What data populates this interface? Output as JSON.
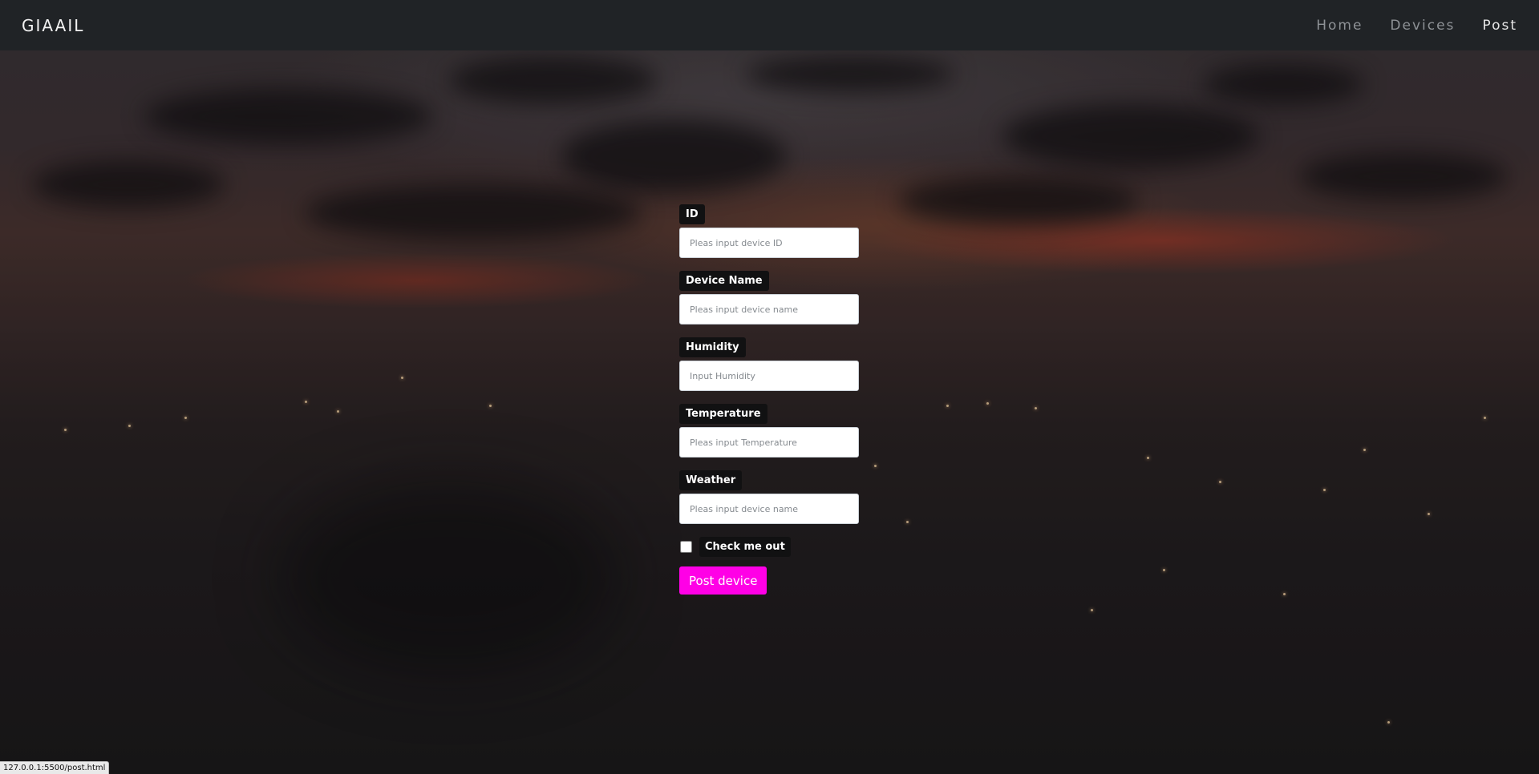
{
  "navbar": {
    "brand": "GIAAIL",
    "links": [
      {
        "label": "Home",
        "active": false
      },
      {
        "label": "Devices",
        "active": false
      },
      {
        "label": "Post",
        "active": true
      }
    ]
  },
  "form": {
    "fields": [
      {
        "label": "ID",
        "placeholder": "Pleas input device ID"
      },
      {
        "label": "Device Name",
        "placeholder": "Pleas input device name"
      },
      {
        "label": "Humidity",
        "placeholder": "Input Humidity"
      },
      {
        "label": "Temperature",
        "placeholder": "Pleas input Temperature"
      },
      {
        "label": "Weather",
        "placeholder": "Pleas input device name"
      }
    ],
    "checkbox_label": "Check me out",
    "checkbox_checked": false,
    "submit_label": "Post device"
  },
  "status_bar": {
    "url": "127.0.0.1:5500/post.html"
  },
  "colors": {
    "navbar_bg": "#202326",
    "accent_button": "#ff00e6",
    "label_bg": "#111112"
  }
}
